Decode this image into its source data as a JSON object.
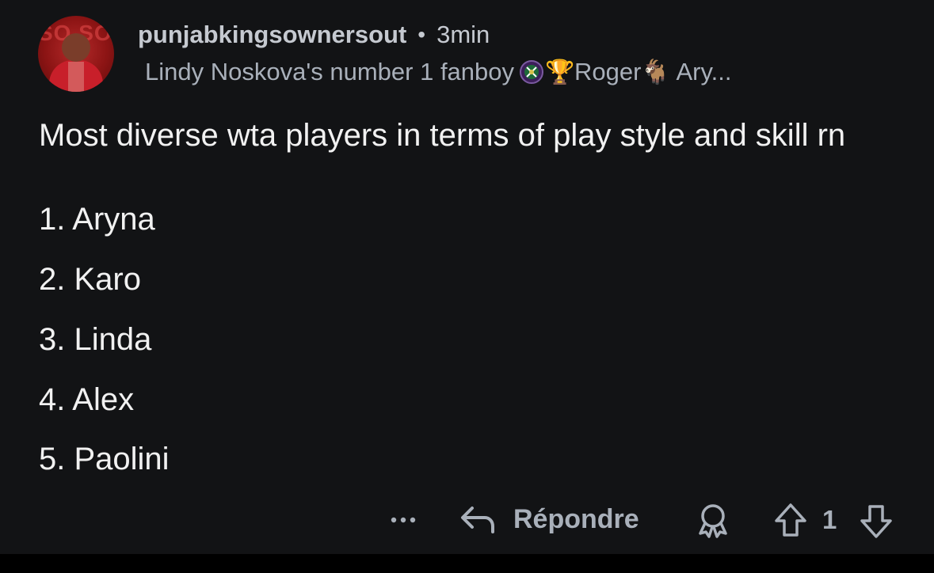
{
  "comment": {
    "username": "punjabkingsownersout",
    "separator": "•",
    "time": "3min",
    "flair": {
      "prefix": "Lindy Noskova's number 1 fanboy",
      "icon1": "wimbledon-logo-icon",
      "icon2": "trophy-icon",
      "icon2_glyph": "🏆",
      "middle": "Roger",
      "icon3": "goat-icon",
      "icon3_glyph": "🐐",
      "suffix": "Ary..."
    },
    "text_line": "Most diverse wta players in terms of play style and skill rn",
    "list": [
      "1.  Aryna",
      "2. Karo",
      "3. Linda",
      "4. Alex",
      "5. Paolini"
    ]
  },
  "actions": {
    "more_icon": "more-horizontal-icon",
    "reply_icon": "reply-arrow-icon",
    "reply_label": "Répondre",
    "award_icon": "award-icon",
    "upvote_icon": "upvote-arrow-icon",
    "vote_count": "1",
    "downvote_icon": "downvote-arrow-icon"
  },
  "colors": {
    "background": "#121315",
    "text_primary": "#f1f1f1",
    "text_secondary": "#a9b0ba",
    "icon": "#a9b0ba"
  }
}
